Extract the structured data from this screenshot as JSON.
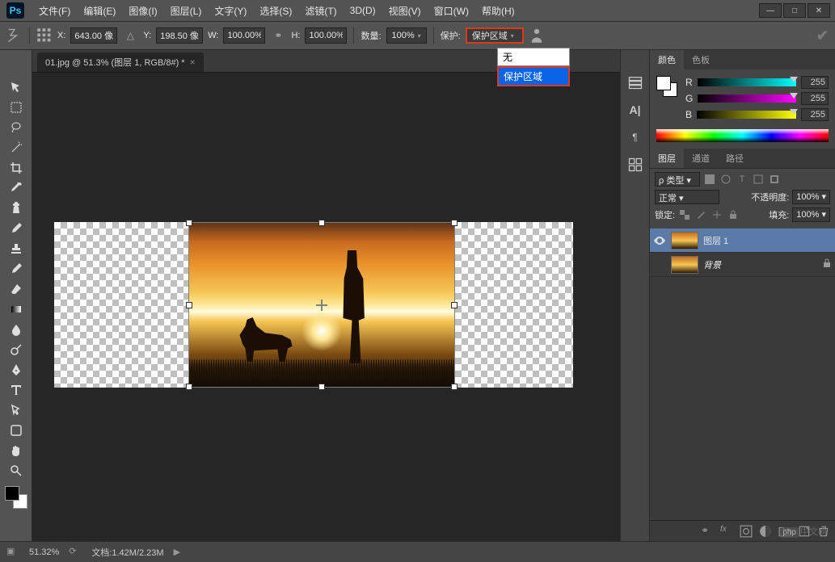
{
  "app": {
    "logo": "Ps"
  },
  "menu": {
    "file": "文件(F)",
    "edit": "编辑(E)",
    "image": "图像(I)",
    "layer": "图层(L)",
    "type": "文字(Y)",
    "select": "选择(S)",
    "filter": "滤镜(T)",
    "threeD": "3D(D)",
    "view": "视图(V)",
    "window": "窗口(W)",
    "help": "帮助(H)"
  },
  "options": {
    "x_label": "X:",
    "x_val": "643.00 像",
    "y_label": "Y:",
    "y_val": "198.50 像",
    "w_label": "W:",
    "w_val": "100.00%",
    "h_label": "H:",
    "h_val": "100.00%",
    "qty_label": "数量:",
    "qty_val": "100%",
    "protect_label": "保护:",
    "protect_val": "保护区域"
  },
  "dropdown": {
    "none": "无",
    "protect": "保护区域"
  },
  "doc": {
    "tab": "01.jpg @ 51.3% (图层 1, RGB/8#) *"
  },
  "colorPanel": {
    "tab_color": "颜色",
    "tab_swatch": "色板",
    "r_label": "R",
    "r_val": "255",
    "g_label": "G",
    "g_val": "255",
    "b_label": "B",
    "b_val": "255"
  },
  "layerPanel": {
    "tab_layers": "图层",
    "tab_channels": "通道",
    "tab_paths": "路径",
    "kind": "ρ 类型",
    "blend": "正常",
    "opacity_label": "不透明度:",
    "opacity_val": "100%",
    "lock_label": "锁定:",
    "fill_label": "填充:",
    "fill_val": "100%",
    "layer1": "图层 1",
    "bg": "背景"
  },
  "status": {
    "zoom": "51.32%",
    "doc": "文档:1.42M/2.23M"
  },
  "watermark": {
    "badge": "php",
    "text": "中文网"
  }
}
